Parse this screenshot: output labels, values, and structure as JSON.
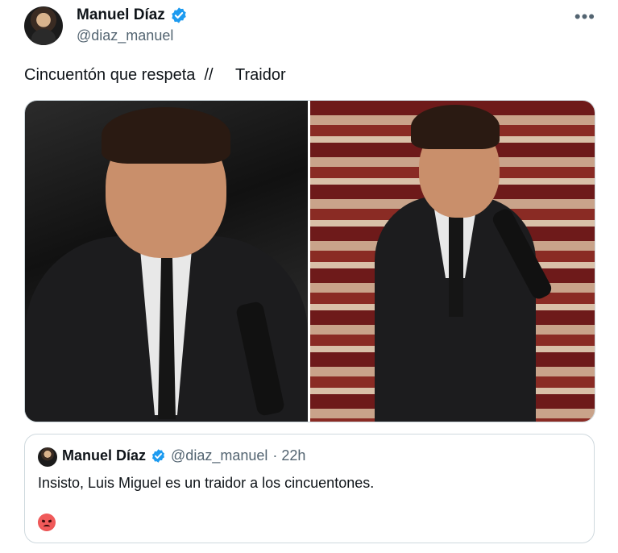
{
  "tweet": {
    "author_name": "Manuel Díaz",
    "author_handle": "@diaz_manuel",
    "more_label": "•••",
    "text": "Cincuentón que respeta  //     Traidor",
    "media": [
      {
        "alt": "photo-left"
      },
      {
        "alt": "photo-right"
      }
    ]
  },
  "quote": {
    "author_name": "Manuel Díaz",
    "author_handle": "@diaz_manuel",
    "time": "· 22h",
    "text": "Insisto, Luis Miguel es un traidor a los cincuentones.",
    "emoji": "angry-face-icon"
  },
  "colors": {
    "verified": "#1d9bf0",
    "secondary_text": "#536471",
    "border": "#cfd9de"
  }
}
